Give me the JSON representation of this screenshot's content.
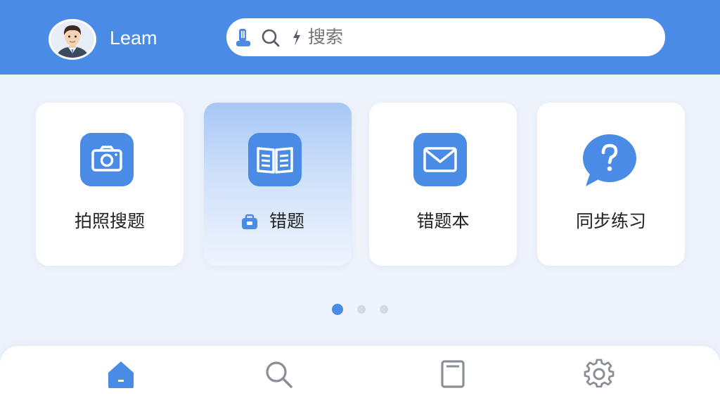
{
  "header": {
    "username": "Leam",
    "search": {
      "placeholder": "搜索",
      "left_icon": "user-badge-icon",
      "search_icon": "search-icon",
      "bolt_icon": "bolt-icon"
    },
    "avatar_icon": "avatar"
  },
  "cards": [
    {
      "label": "拍照搜题",
      "icon": "camera-icon",
      "active": false
    },
    {
      "label": "错题",
      "icon": "open-book-icon",
      "active": true,
      "label_icon": "briefcase-icon"
    },
    {
      "label": "错题本",
      "icon": "envelope-icon",
      "active": false
    },
    {
      "label": "同步练习",
      "icon": "question-bubble-icon",
      "active": false
    }
  ],
  "pagination": {
    "count": 3,
    "active_index": 0
  },
  "bottom_nav": [
    {
      "name": "home",
      "icon": "home-icon",
      "active": true
    },
    {
      "name": "search",
      "icon": "search-icon",
      "active": false
    },
    {
      "name": "notebook",
      "icon": "notebook-icon",
      "active": false
    },
    {
      "name": "settings",
      "icon": "gear-icon",
      "active": false
    }
  ],
  "colors": {
    "accent": "#4a8be6",
    "page_bg": "#eef3fb",
    "inactive_icon": "#8a8f97",
    "dot_inactive": "#d5d9e0"
  }
}
